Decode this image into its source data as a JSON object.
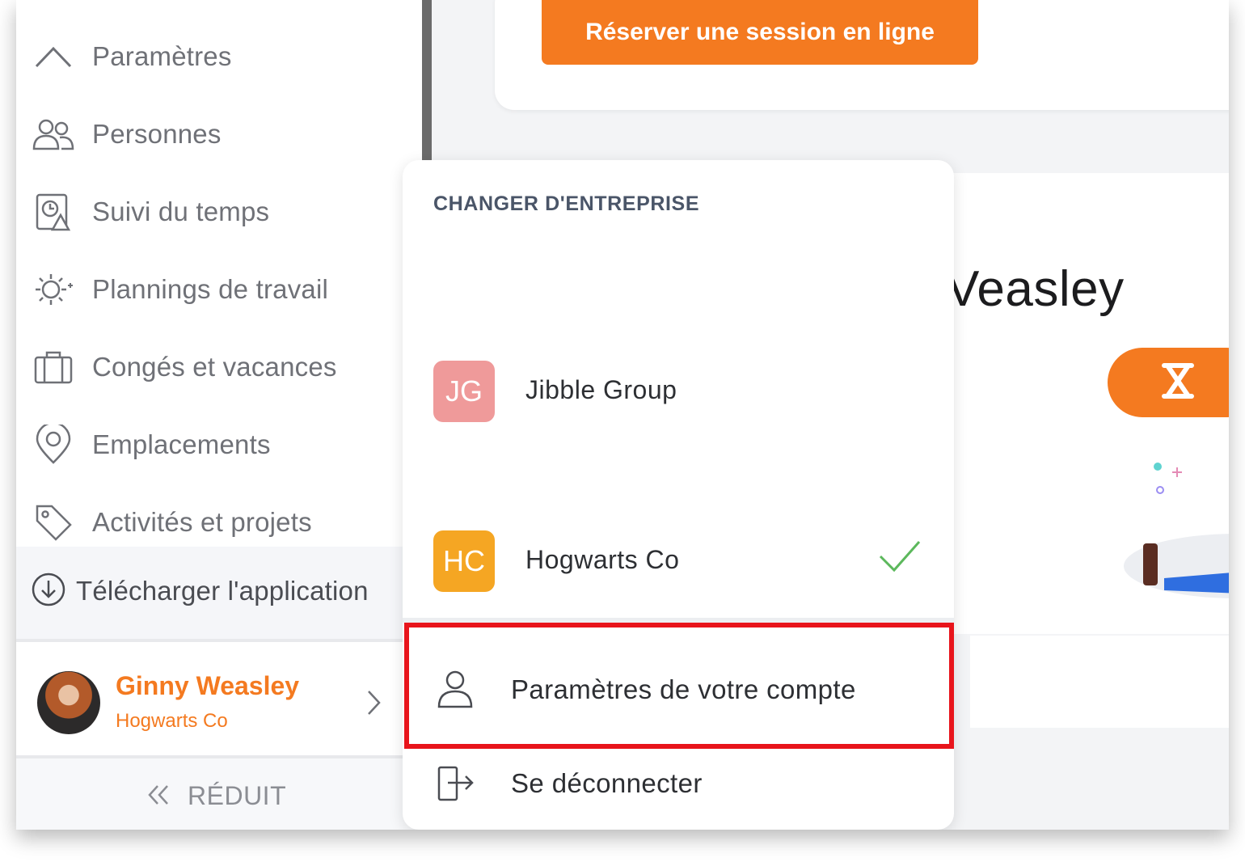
{
  "sidebar": {
    "items": [
      {
        "label": "Paramètres",
        "icon": "chevron-up-icon"
      },
      {
        "label": "Personnes",
        "icon": "people-icon"
      },
      {
        "label": "Suivi du temps",
        "icon": "time-tracking-icon"
      },
      {
        "label": "Plannings de travail",
        "icon": "schedule-icon"
      },
      {
        "label": "Congés et vacances",
        "icon": "briefcase-icon"
      },
      {
        "label": "Emplacements",
        "icon": "location-pin-icon"
      },
      {
        "label": "Activités et projets",
        "icon": "tag-icon"
      }
    ],
    "download_label": "Télécharger l'application",
    "user": {
      "name": "Ginny Weasley",
      "company": "Hogwarts Co"
    },
    "collapse_label": "RÉDUIT"
  },
  "main": {
    "book_button": "Réserver une session en ligne",
    "welcome_name_fragment": "Veasley"
  },
  "dropdown": {
    "header": "CHANGER D'ENTREPRISE",
    "companies": [
      {
        "initials": "JG",
        "name": "Jibble Group",
        "color": "#ef9a9a",
        "selected": false
      },
      {
        "initials": "HC",
        "name": "Hogwarts Co",
        "color": "#f5a623",
        "selected": true
      }
    ],
    "account_settings": "Paramètres de votre compte",
    "logout": "Se déconnecter"
  },
  "colors": {
    "accent": "#f47a20",
    "highlight": "#e8141b",
    "check": "#5cb85c"
  }
}
